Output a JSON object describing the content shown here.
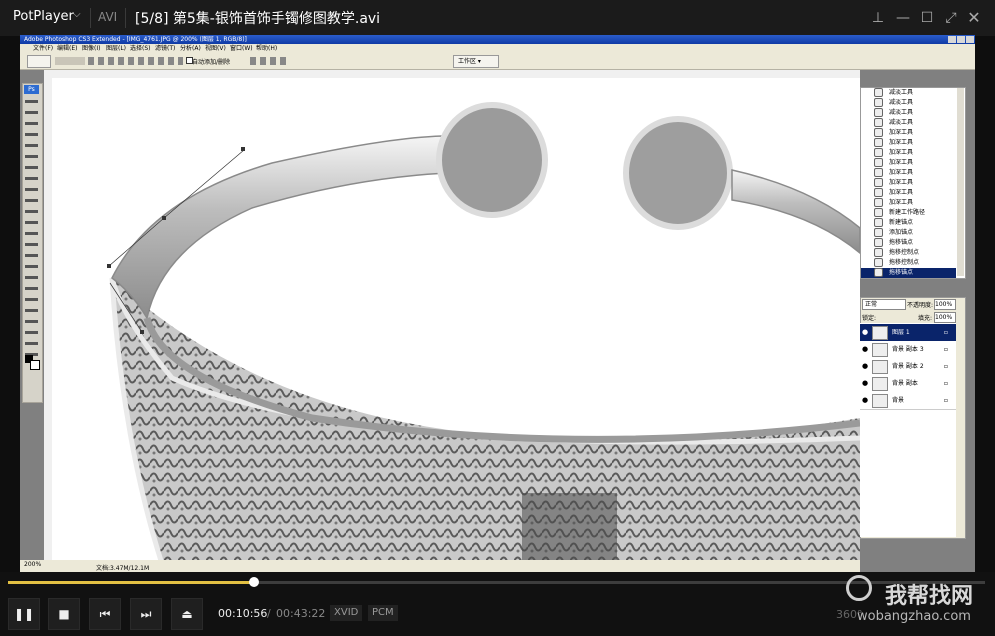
{
  "player": {
    "logo": "PotPlayer",
    "format_tag": "AVI",
    "file_title": "[5/8] 第5集-银饰首饰手镯修图教学.avi",
    "current_time": "00:10:56",
    "time_separator": "/",
    "total_time": "00:43:22",
    "progress_fraction": 0.2522,
    "video_codec": "XVID",
    "audio_codec": "PCM",
    "watermark_brand": "我帮找网",
    "watermark_url": "wobangzhao.com",
    "watermark_badge": "360°",
    "accent_color": "#e3c043"
  },
  "photoshop": {
    "window_title": "Adobe Photoshop CS3 Extended - [IMG_4761.JPG @ 200% (图层 1, RGB/8)]",
    "menus": [
      "文件(F)",
      "编辑(E)",
      "图像(I)",
      "图层(L)",
      "选择(S)",
      "滤镜(T)",
      "分析(A)",
      "视图(V)",
      "窗口(W)",
      "帮助(H)"
    ],
    "options_bar": {
      "auto_add_delete": "自动添加/删除",
      "workspace": "工作区 ▾"
    },
    "toolbox_logo": "Ps",
    "status": {
      "zoom": "200%",
      "doc_info": "文档:3.47M/12.1M"
    },
    "history": [
      {
        "label": "减淡工具",
        "selected": false
      },
      {
        "label": "减淡工具",
        "selected": false
      },
      {
        "label": "减淡工具",
        "selected": false
      },
      {
        "label": "减淡工具",
        "selected": false
      },
      {
        "label": "加深工具",
        "selected": false
      },
      {
        "label": "加深工具",
        "selected": false
      },
      {
        "label": "加深工具",
        "selected": false
      },
      {
        "label": "加深工具",
        "selected": false
      },
      {
        "label": "加深工具",
        "selected": false
      },
      {
        "label": "加深工具",
        "selected": false
      },
      {
        "label": "加深工具",
        "selected": false
      },
      {
        "label": "加深工具",
        "selected": false
      },
      {
        "label": "新建工作路径",
        "selected": false
      },
      {
        "label": "新建锚点",
        "selected": false
      },
      {
        "label": "添加锚点",
        "selected": false
      },
      {
        "label": "拖移锚点",
        "selected": false
      },
      {
        "label": "拖移控制点",
        "selected": false
      },
      {
        "label": "拖移控制点",
        "selected": false
      },
      {
        "label": "拖移锚点",
        "selected": true
      }
    ],
    "layers_panel": {
      "blend_mode": "正常",
      "opacity_label": "不透明度:",
      "opacity": "100%",
      "lock_label": "锁定:",
      "fill_label": "填充:",
      "fill": "100%",
      "layers": [
        {
          "name": "图层 1",
          "selected": true
        },
        {
          "name": "背景 副本 3",
          "selected": false
        },
        {
          "name": "背景 副本 2",
          "selected": false
        },
        {
          "name": "背景 副本",
          "selected": false
        },
        {
          "name": "背景",
          "selected": false
        }
      ]
    }
  }
}
